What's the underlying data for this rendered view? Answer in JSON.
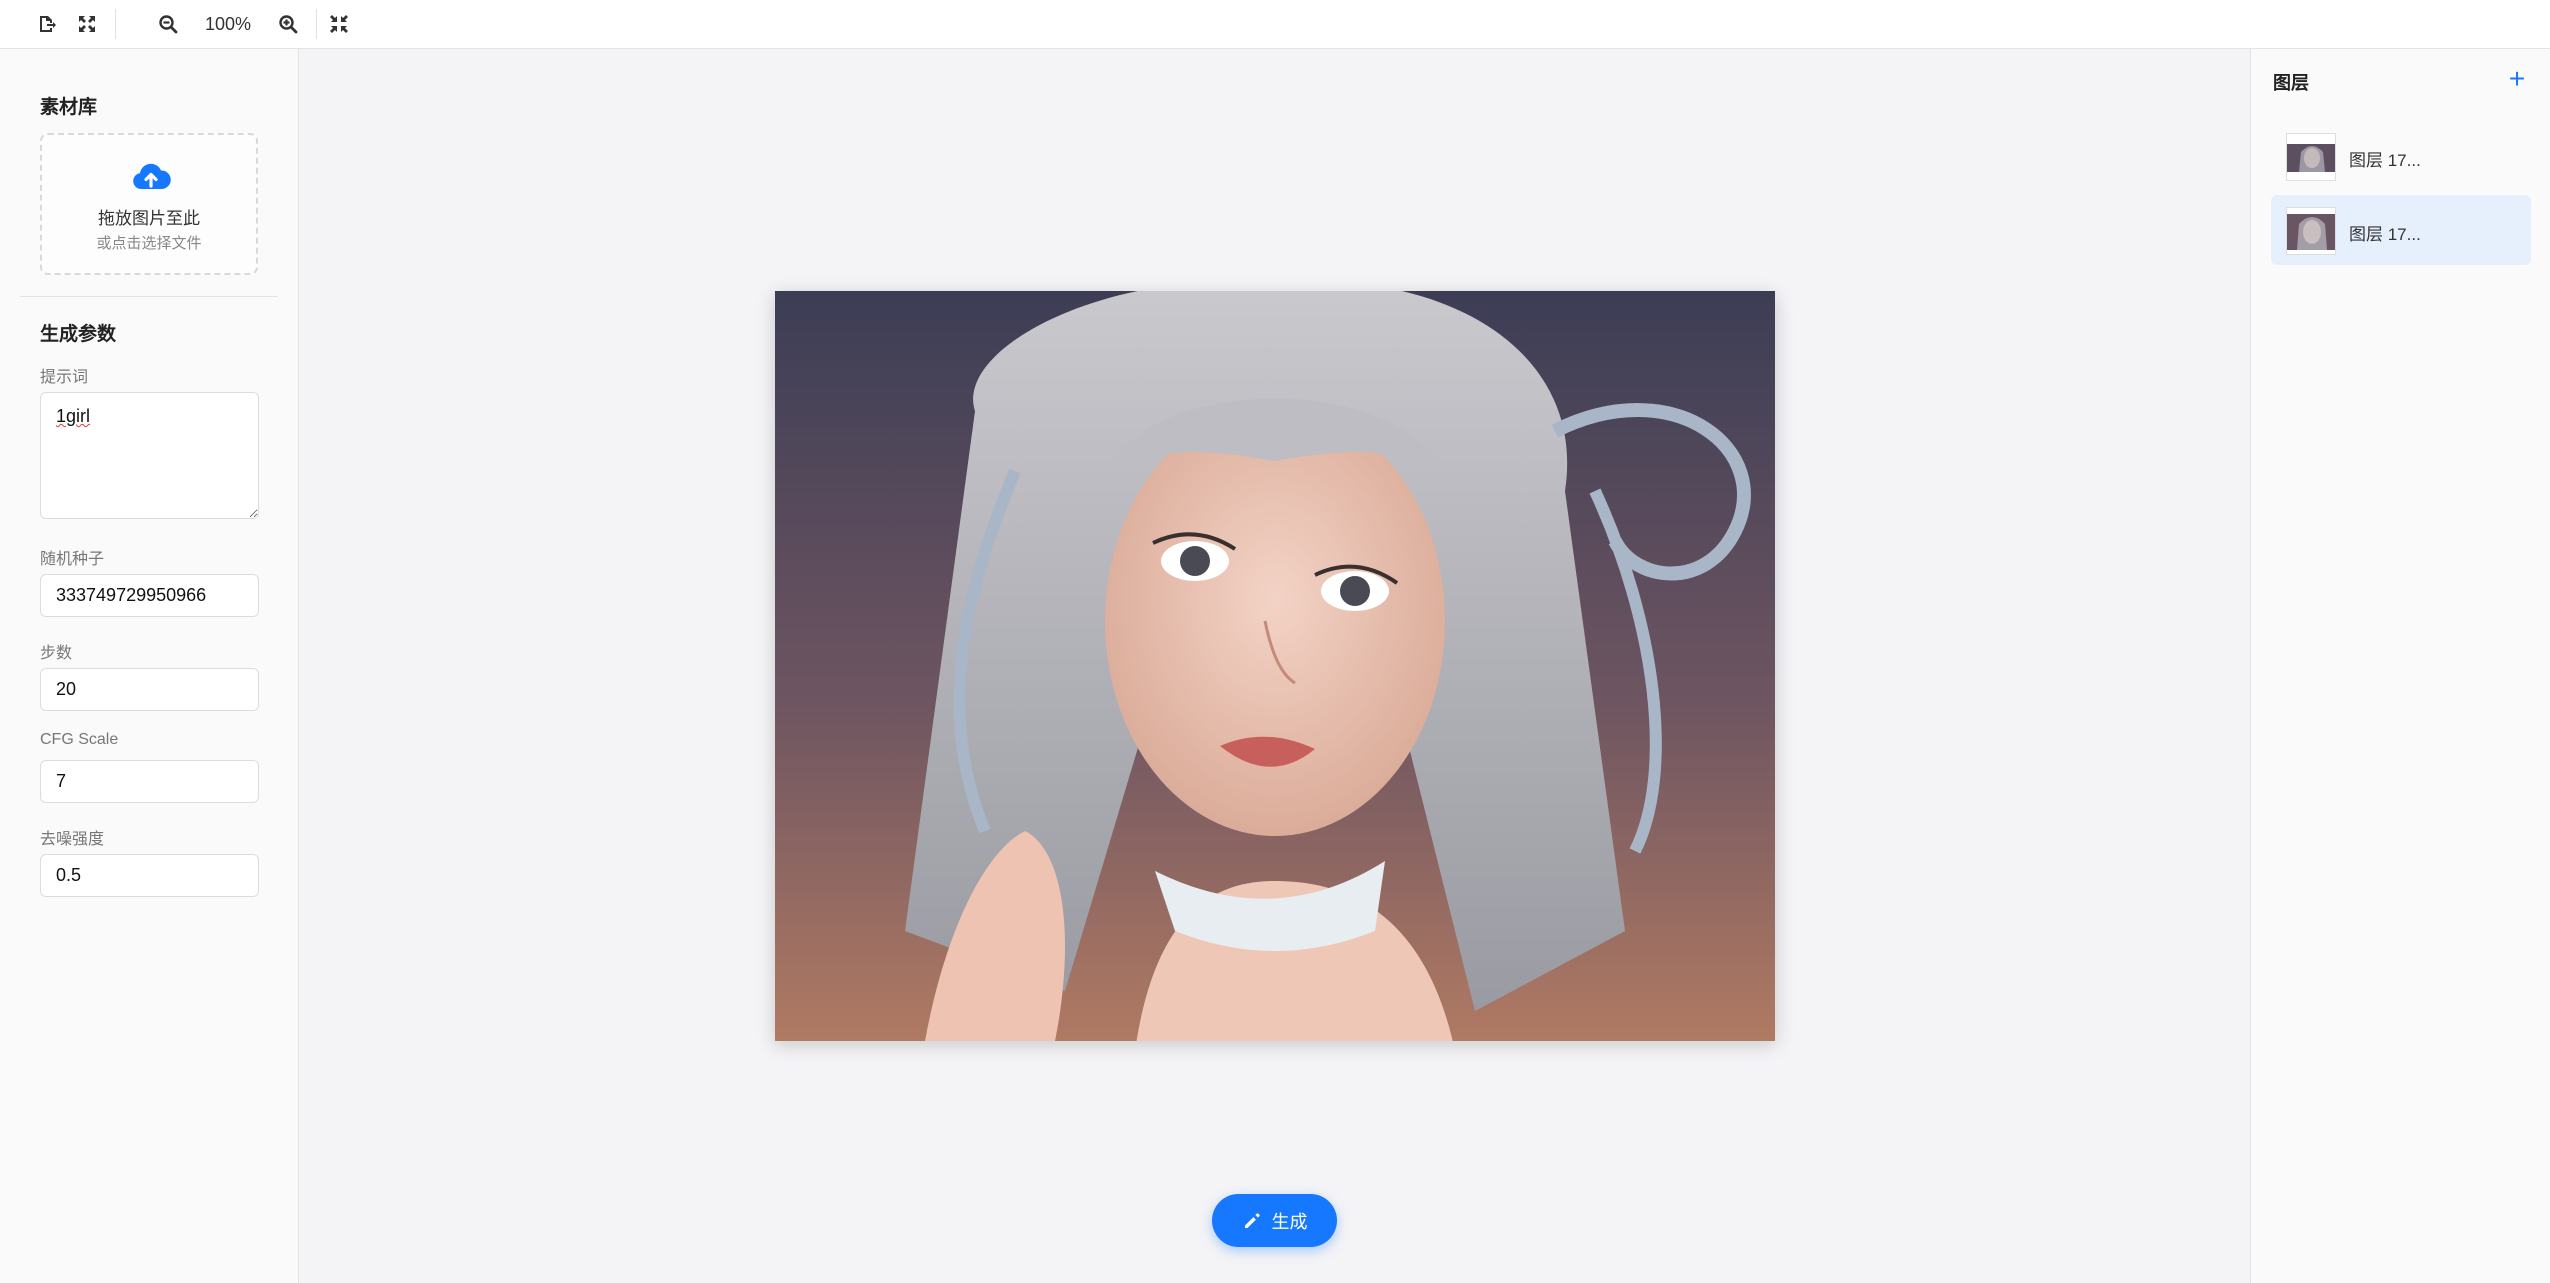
{
  "toolbar": {
    "export_icon": "file-export-icon",
    "fit_icon": "expand-icon",
    "zoom_out_icon": "zoom-out-icon",
    "zoom_level": "100%",
    "zoom_in_icon": "zoom-in-icon",
    "reset_icon": "compress-icon"
  },
  "assets": {
    "title": "素材库",
    "upload_icon": "cloud-upload-icon",
    "upload_main": "拖放图片至此",
    "upload_sub": "或点击选择文件"
  },
  "params": {
    "title": "生成参数",
    "prompt_label": "提示词",
    "prompt_value": "1girl",
    "seed_label": "随机种子",
    "seed_value": "333749729950966",
    "steps_label": "步数",
    "steps_value": "20",
    "cfg_label": "CFG Scale",
    "cfg_value": "7",
    "denoise_label": "去噪强度",
    "denoise_value": "0.5"
  },
  "canvas": {
    "generate_label": "生成",
    "generate_icon": "pencil-icon"
  },
  "layers": {
    "title": "图层",
    "add_icon": "plus-icon",
    "add_symbol": "+",
    "items": [
      {
        "name": "图层 17...",
        "selected": false
      },
      {
        "name": "图层 17...",
        "selected": true
      }
    ]
  },
  "colors": {
    "accent": "#1677ff",
    "selected_bg": "#e6f0fd"
  }
}
